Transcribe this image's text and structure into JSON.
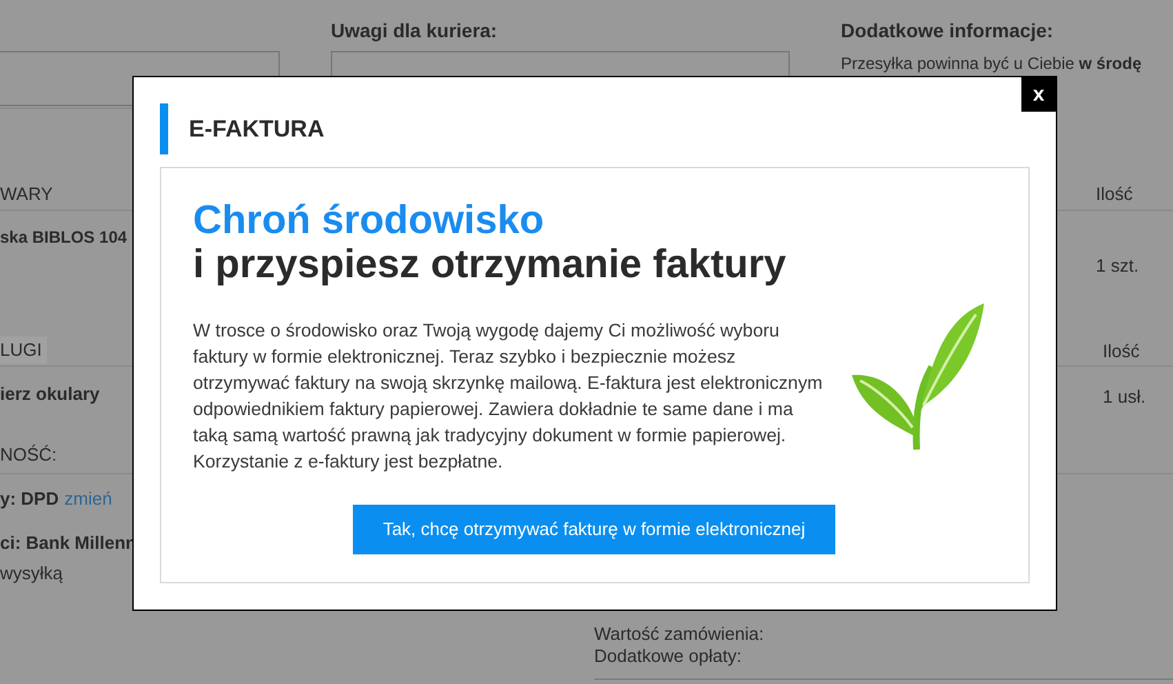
{
  "page": {
    "courier_notes_label": "Uwagi dla kuriera:",
    "extra_info_label": "Dodatkowe informacje:",
    "delivery_note": "Przesyłka powinna być u Ciebie **w środę**",
    "products_header": "WARY",
    "products_qty_header": "Ilość",
    "product_name": "ska BIBLOS 104",
    "product_qty": "1 szt.",
    "services_header": "LUGI",
    "services_qty_header": "Ilość",
    "service_name": "ierz okulary",
    "service_qty": "1 usł.",
    "delivery_header": "NOŚĆ:",
    "courier_label": "y: DPD",
    "courier_change_link": "zmień",
    "payment_label": "ci: Bank Millenn",
    "payment_note": "wysyłką",
    "order_value_label": "Wartość zamówienia:",
    "extra_fees_label": "Dodatkowe opłaty:"
  },
  "modal": {
    "title": "E-FAKTURA",
    "close": "x",
    "headline_1": "Chroń środowisko",
    "headline_2": "i przyspiesz otrzymanie faktury",
    "body": "W trosce o środowisko oraz Twoją wygodę dajemy Ci możliwość wyboru faktury w formie elektronicznej. Teraz szybko i bezpiecznie możesz otrzymywać faktury na swoją skrzynkę mailową. E-faktura jest elektronicznym odpowiednikiem faktury papierowej. Zawiera dokładnie te same dane i ma taką samą wartość prawną jak tradycyjny dokument w formie papierowej. Korzystanie z e-faktury jest bezpłatne.",
    "button": "Tak, chcę otrzymywać fakturę w formie elektronicznej"
  }
}
